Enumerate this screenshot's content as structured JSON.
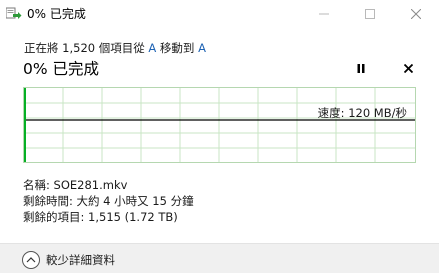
{
  "window": {
    "title": "0% 已完成"
  },
  "header": {
    "subtitle_prefix": "正在將 1,520 個項目從",
    "source": "A",
    "subtitle_middle": "移動到",
    "destination": "A",
    "progress_headline": "0% 已完成"
  },
  "graph": {
    "speed_label": "速度: 120 MB/秒",
    "progress": 0.0
  },
  "details": {
    "name_row": "名稱: SOE281.mkv",
    "time_row": "剩餘時間: 大約 4 小時又 15 分鐘",
    "items_row": "剩餘的項目: 1,515 (1.72 TB)"
  },
  "footer": {
    "collapse_label": "較少詳細資料"
  },
  "icons": {
    "app": "move-files-icon",
    "pause": "pause-icon",
    "cancel": "close-icon",
    "collapse": "chevron-up-icon"
  },
  "colors": {
    "link": "#1e63b4",
    "graph_border": "#b5d7b0",
    "graph_grid": "#c9e6c4",
    "graph_fill": "#06b025"
  }
}
